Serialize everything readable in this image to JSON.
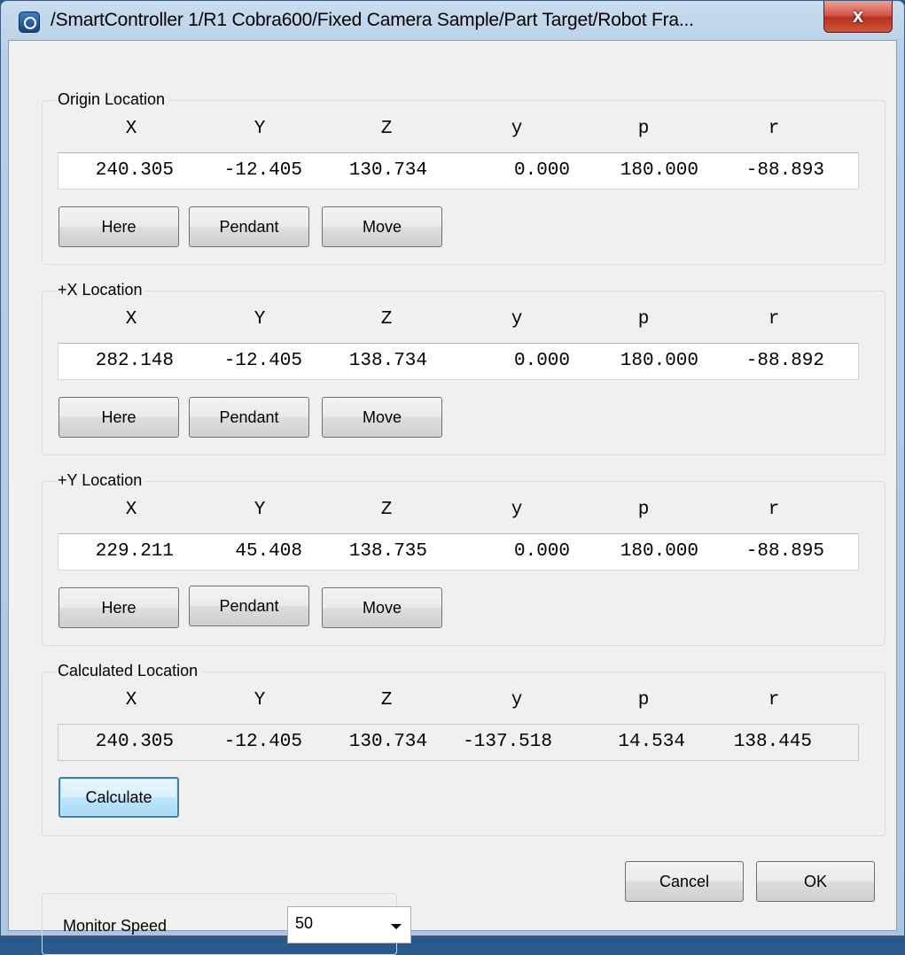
{
  "window": {
    "title": "/SmartController 1/R1 Cobra600/Fixed Camera Sample/Part Target/Robot Fra...",
    "close_label": "x"
  },
  "columns": [
    "X",
    "Y",
    "Z",
    "y",
    "p",
    "r"
  ],
  "groups": [
    {
      "label": "Origin Location",
      "values": [
        "240.305",
        "-12.405",
        "130.734",
        "0.000",
        "180.000",
        "-88.893"
      ],
      "buttons": [
        "Here",
        "Pendant",
        "Move"
      ]
    },
    {
      "label": "+X Location",
      "values": [
        "282.148",
        "-12.405",
        "138.734",
        "0.000",
        "180.000",
        "-88.892"
      ],
      "buttons": [
        "Here",
        "Pendant",
        "Move"
      ]
    },
    {
      "label": "+Y Location",
      "values": [
        "229.211",
        "45.408",
        "138.735",
        "0.000",
        "180.000",
        "-88.895"
      ],
      "buttons": [
        "Here",
        "Pendant",
        "Move"
      ]
    },
    {
      "label": "Calculated Location",
      "values": [
        "240.305",
        "-12.405",
        "130.734",
        "-137.518",
        "14.534",
        "138.445"
      ],
      "buttons": [
        "Calculate"
      ]
    }
  ],
  "monitor_speed": {
    "label": "Monitor Speed",
    "value": "50"
  },
  "footer": {
    "cancel_label": "Cancel",
    "ok_label": "OK"
  },
  "colors": {
    "title_gradient": "#b7cfe8",
    "client_bg": "#f0f0f0",
    "close_red": "#c8453a"
  },
  "icons": {
    "app": "application-icon",
    "close": "close-icon",
    "dropdown": "chevron-down-icon"
  }
}
